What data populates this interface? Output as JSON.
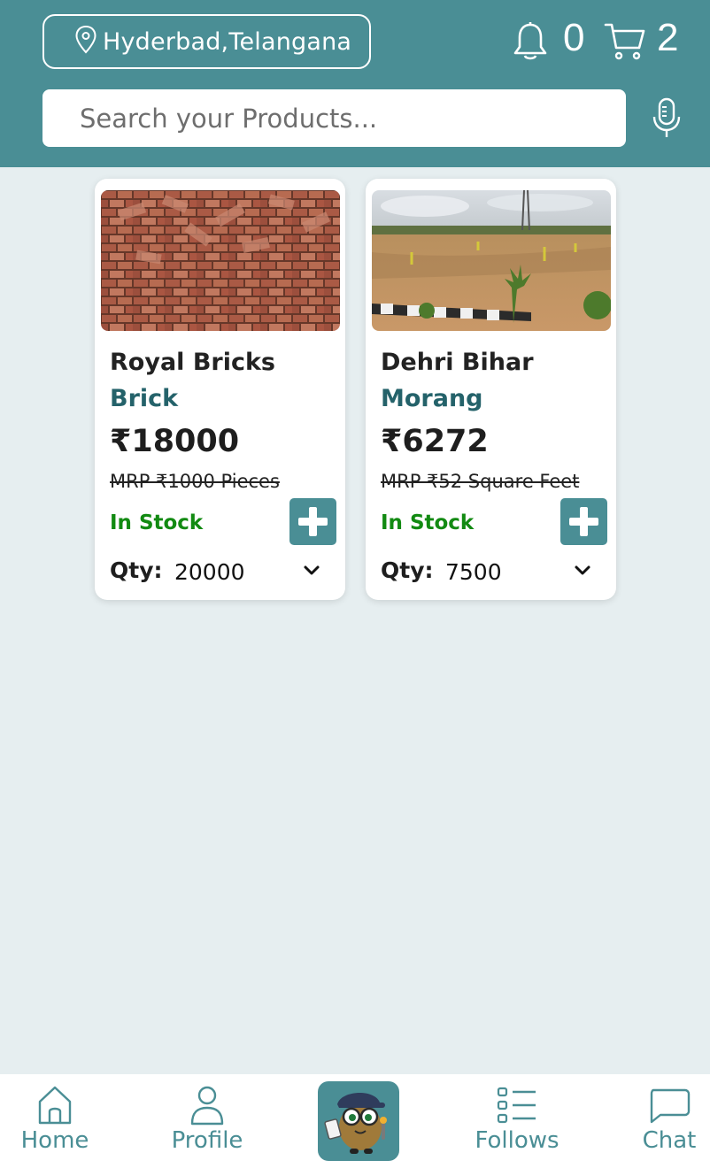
{
  "header": {
    "location": "Hyderbad,Telangana",
    "notification_count": "0",
    "cart_count": "2",
    "search_placeholder": "Search your Products..."
  },
  "products": [
    {
      "name": "Royal Bricks",
      "category": "Brick",
      "price": "₹18000",
      "mrp": "MRP ₹1000 Pieces",
      "stock": "In Stock",
      "qty_label": "Qty:",
      "qty_value": "20000"
    },
    {
      "name": "Dehri Bihar",
      "category": "Morang",
      "price": "₹6272",
      "mrp": "MRP ₹52 Square Feet",
      "stock": "In Stock",
      "qty_label": "Qty:",
      "qty_value": "7500"
    }
  ],
  "nav": {
    "home": "Home",
    "profile": "Profile",
    "follows": "Follows",
    "chat": "Chat"
  },
  "colors": {
    "brand": "#4a8e95",
    "stock_green": "#128a12",
    "category": "#24626a",
    "background": "#e6eef0"
  },
  "icons": [
    "location-pin-icon",
    "bell-icon",
    "cart-icon",
    "microphone-icon",
    "plus-icon",
    "chevron-down-icon",
    "home-icon",
    "profile-icon",
    "mascot-icon",
    "follows-list-icon",
    "chat-icon"
  ]
}
